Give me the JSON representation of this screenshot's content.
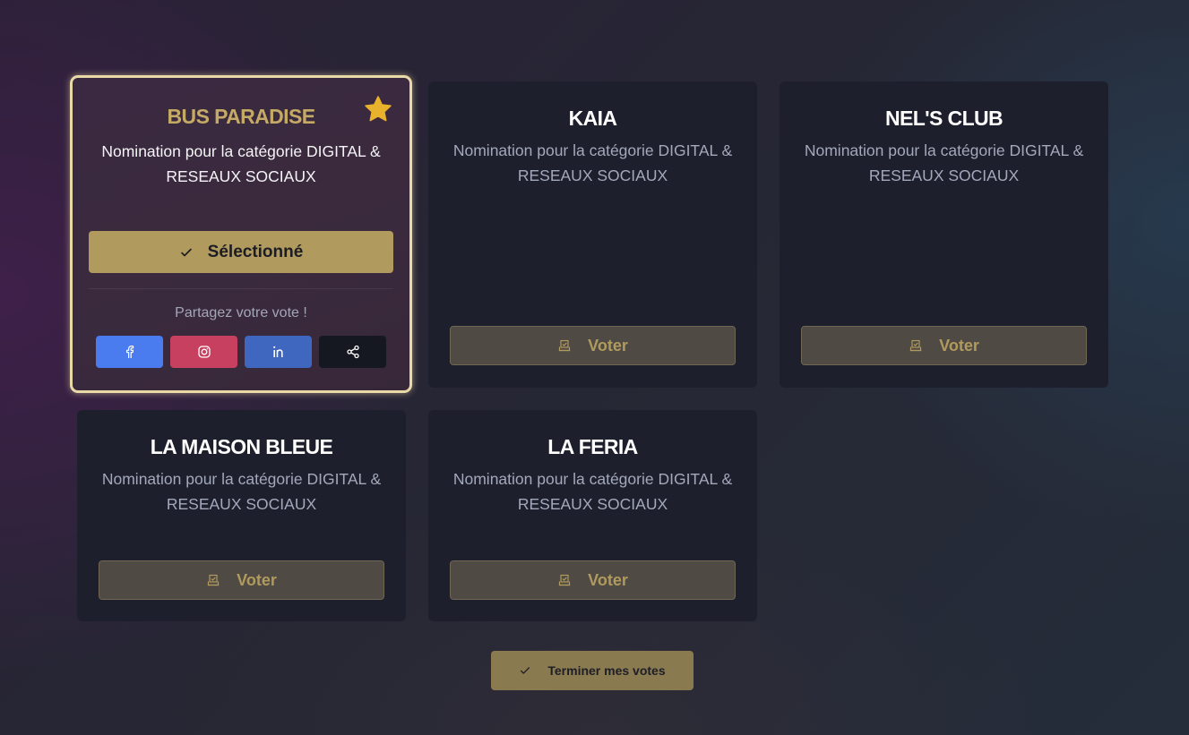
{
  "nominees": [
    {
      "name": "BUS PARADISE",
      "description": "Nomination pour la catégorie DIGITAL & RESEAUX SOCIAUX",
      "selected": true,
      "selected_label": "Sélectionné",
      "share_label": "Partagez votre vote !",
      "share_buttons": [
        {
          "icon": "facebook-icon",
          "color": "#4a7cf0"
        },
        {
          "icon": "instagram-icon",
          "color": "#c8405f"
        },
        {
          "icon": "linkedin-icon",
          "color": "#3f67c0"
        },
        {
          "icon": "share-icon",
          "color": "#161821"
        }
      ]
    },
    {
      "name": "KAIA",
      "description": "Nomination pour la catégorie DIGITAL & RESEAUX SOCIAUX",
      "vote_label": "Voter"
    },
    {
      "name": "NEL'S CLUB",
      "description": "Nomination pour la catégorie DIGITAL & RESEAUX SOCIAUX",
      "vote_label": "Voter"
    },
    {
      "name": "LA MAISON BLEUE",
      "description": "Nomination pour la catégorie DIGITAL & RESEAUX SOCIAUX",
      "vote_label": "Voter"
    },
    {
      "name": "LA FERIA",
      "description": "Nomination pour la catégorie DIGITAL & RESEAUX SOCIAUX",
      "vote_label": "Voter"
    }
  ],
  "finish_label": "Terminer mes votes",
  "icons": {
    "selected_badge": "star-icon",
    "selected_button": "check-icon",
    "vote_button": "ballot-box-icon",
    "finish_button": "check-icon"
  },
  "colors": {
    "accent_gold": "#b09a5e",
    "selected_border": "#e9d9a6",
    "star": "#e8b22d",
    "card_bg": "#1d1f2c"
  }
}
